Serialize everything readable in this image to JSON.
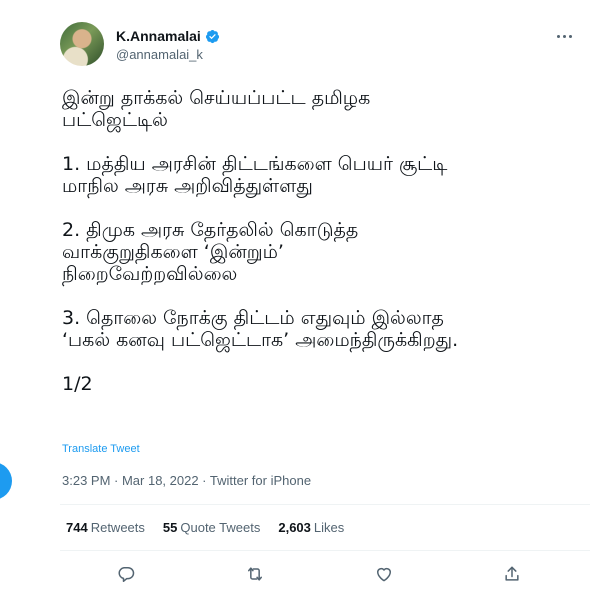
{
  "author": {
    "display_name": "K.Annamalai",
    "handle": "@annamalai_k",
    "verified": true
  },
  "tweet": {
    "paragraphs": [
      [
        "இன்று தாக்கல் செய்யப்பட்ட தமிழக",
        "பட்ஜெட்டில்"
      ],
      [
        "1. மத்திய அரசின் திட்டங்களை பெயர் சூட்டி",
        "மாநில அரசு அறிவித்துள்ளது"
      ],
      [
        "2. திமுக அரசு தேர்தலில் கொடுத்த",
        "வாக்குறுதிகளை ‘இன்றும்’",
        "நிறைவேற்றவில்லை"
      ],
      [
        "3. தொலை நோக்கு திட்டம் எதுவும் இல்லாத",
        "‘பகல் கனவு பட்ஜெட்டாக’ அமைந்திருக்கிறது."
      ],
      [
        "1/2"
      ]
    ],
    "translate_label": "Translate Tweet",
    "timestamp": "3:23 PM · Mar 18, 2022 · Twitter for iPhone"
  },
  "stats": {
    "retweets_count": "744",
    "retweets_label": "Retweets",
    "quotes_count": "55",
    "quotes_label": "Quote Tweets",
    "likes_count": "2,603",
    "likes_label": "Likes"
  },
  "colors": {
    "accent": "#1d9bf0",
    "text": "#0f1419",
    "secondary": "#536471",
    "divider": "#eff3f4"
  },
  "icons": {
    "more": "more-icon",
    "verified": "verified-icon",
    "reply": "reply-icon",
    "retweet": "retweet-icon",
    "like": "like-icon",
    "share": "share-icon"
  }
}
